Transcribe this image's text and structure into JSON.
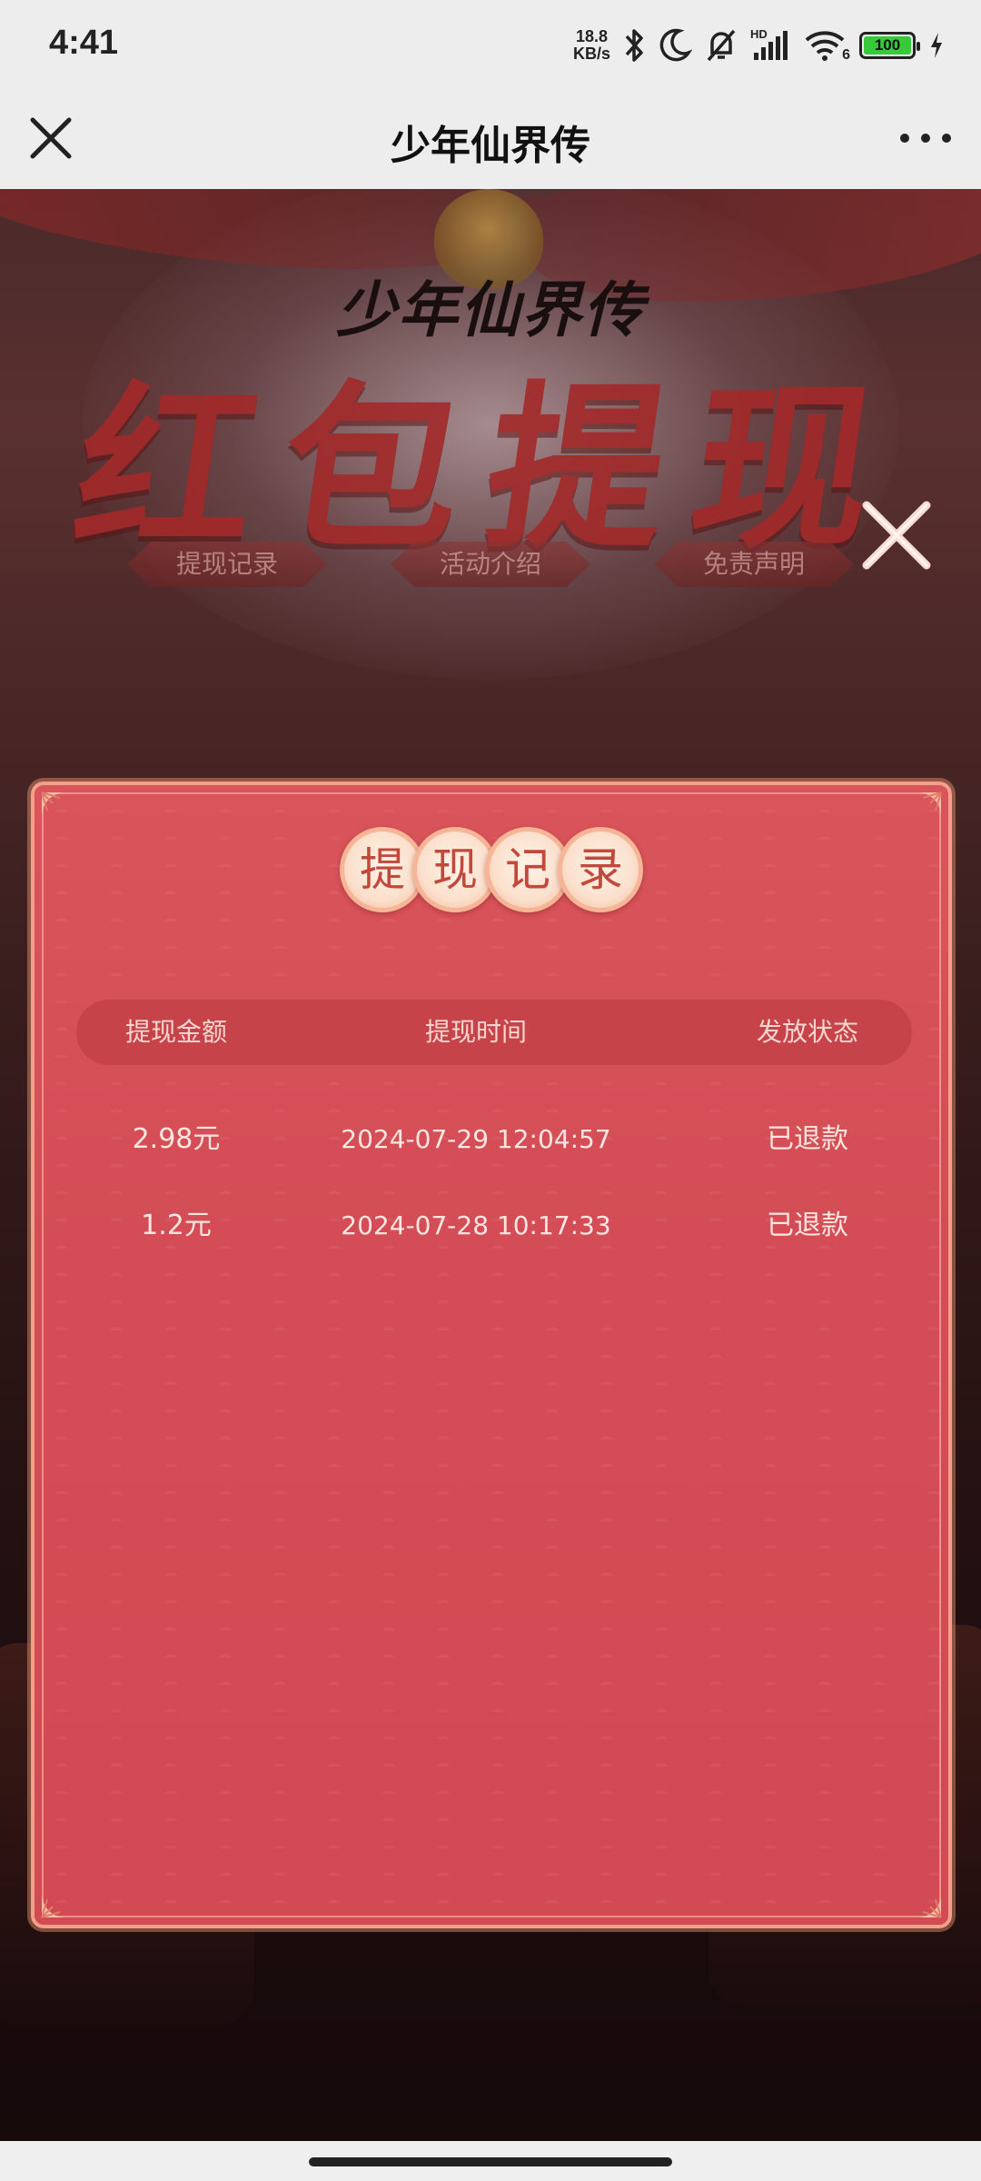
{
  "status_bar": {
    "time": "4:41",
    "net_speed_value": "18.8",
    "net_speed_unit": "KB/s",
    "battery": "100",
    "signal_label": "HD",
    "wifi_label": "6"
  },
  "nav": {
    "title": "少年仙界传"
  },
  "banner": {
    "logo": "少年仙界传",
    "title": "红包提现",
    "tabs": [
      "提现记录",
      "活动介绍",
      "免责声明"
    ]
  },
  "modal": {
    "title_chars": [
      "提",
      "现",
      "记",
      "录"
    ],
    "columns": {
      "amount": "提现金额",
      "time": "提现时间",
      "status": "发放状态"
    },
    "rows": [
      {
        "amount": "2.98元",
        "time": "2024-07-29 12:04:57",
        "status": "已退款"
      },
      {
        "amount": "1.2元",
        "time": "2024-07-28 10:17:33",
        "status": "已退款"
      }
    ]
  },
  "colors": {
    "modal_bg": "#d44d56",
    "modal_border": "#f2a08a",
    "header_row": "#c7434a",
    "title_text": "#c2483c"
  }
}
